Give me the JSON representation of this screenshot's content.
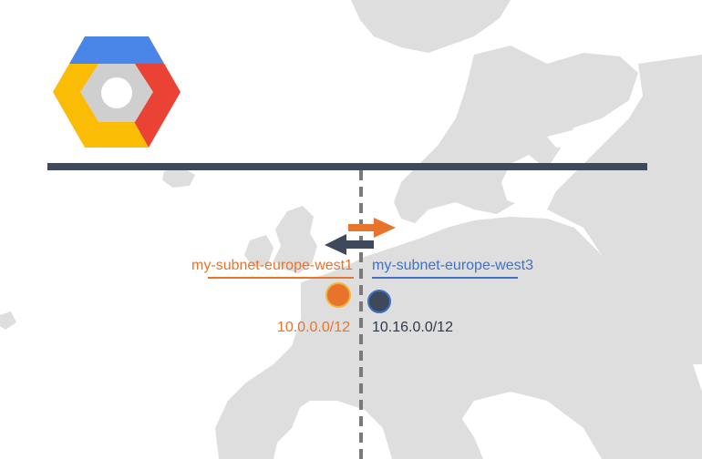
{
  "logo": {
    "icon": "google-cloud-compute-engine-icon",
    "colors": {
      "blue": "#4a86e8",
      "red": "#ea4335",
      "yellow": "#fbbc05",
      "inner": "#cfcfcf",
      "hole": "#ffffff"
    }
  },
  "vpc_bar": {
    "color": "#3e4a5c"
  },
  "arrows": {
    "to_west3_color": "#e8742b",
    "to_west1_color": "#3e4a5c"
  },
  "subnets": [
    {
      "name": "my-subnet-europe-west1",
      "cidr": "10.0.0.0/12",
      "label_color": "#e8742b",
      "cidr_color": "#e8742b",
      "node_fill": "#e8742b",
      "node_border": "#f3b43a"
    },
    {
      "name": "my-subnet-europe-west3",
      "cidr": "10.16.0.0/12",
      "label_color": "#3f72c6",
      "cidr_color": "#2e3a4c",
      "node_fill": "#3e4a5c",
      "node_border": "#3f72c6"
    }
  ],
  "map": {
    "land_color": "#dedede"
  }
}
